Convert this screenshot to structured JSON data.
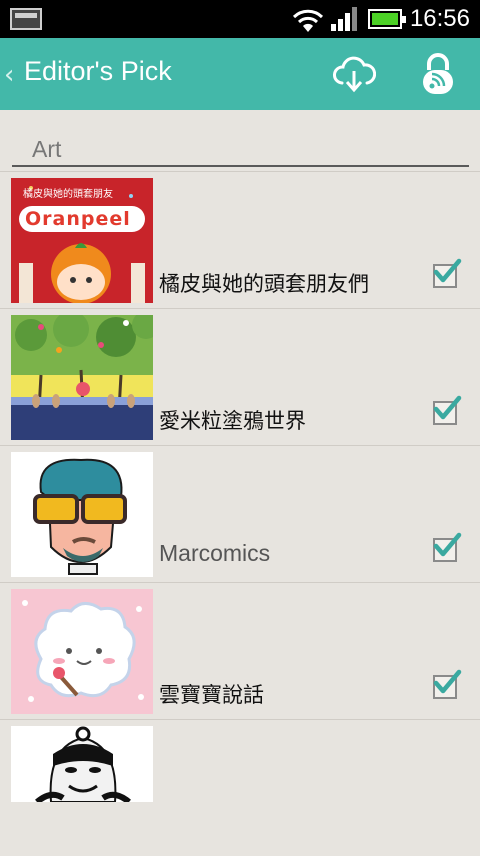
{
  "status_bar": {
    "time": "16:56"
  },
  "action_bar": {
    "title": "Editor's Pick"
  },
  "section": {
    "label": "Art"
  },
  "items": [
    {
      "title": "橘皮與她的頭套朋友們",
      "checked": true,
      "thumb_caption": "橘皮與她的頭套朋友",
      "thumb_logo": "Oranpeel"
    },
    {
      "title": "愛米粒塗鴉世界",
      "checked": true
    },
    {
      "title": "Marcomics",
      "checked": true
    },
    {
      "title": "雲寶寶說話",
      "checked": true
    },
    {
      "title": "",
      "checked": false
    }
  ],
  "colors": {
    "accent": "#43b8a9",
    "check": "#3aa9a0",
    "background": "#e7e4df"
  },
  "icons": [
    "back-chevron-icon",
    "cloud-download-icon",
    "lock-rss-icon",
    "checkmark-icon"
  ]
}
